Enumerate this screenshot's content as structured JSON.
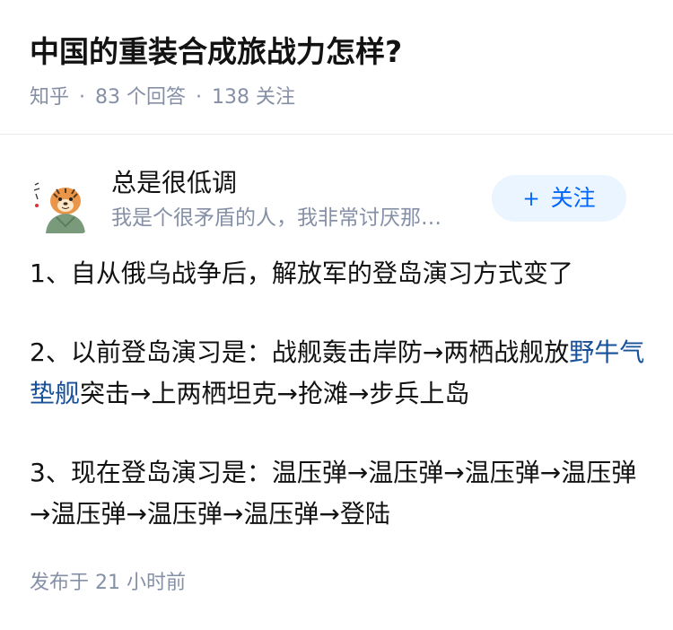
{
  "question": {
    "title": "中国的重装合成旅战力怎样?",
    "source": "知乎",
    "separator": "·",
    "answers_label": "83 个回答",
    "followers_label": "138 关注"
  },
  "author": {
    "name": "总是很低调",
    "bio": "我是个很矛盾的人，我非常讨厌那…",
    "follow_plus": "+",
    "follow_label": "关注"
  },
  "answer": {
    "p1": "1、自从俄乌战争后，解放军的登岛演习方式变了",
    "p2_before": "2、以前登岛演习是：战舰轰击岸防→两栖战舰放",
    "p2_link": "野牛气垫舰",
    "p2_after": "突击→上两栖坦克→抢滩→步兵上岛",
    "p3": "3、现在登岛演习是：温压弹→温压弹→温压弹→温压弹→温压弹→温压弹→温压弹→登陆"
  },
  "footer": {
    "published": "发布于  21 小时前"
  },
  "colors": {
    "title": "#121212",
    "meta": "#8590a6",
    "link": "#175199",
    "accent": "#0066ff",
    "follow_bg": "#ebf5ff"
  }
}
